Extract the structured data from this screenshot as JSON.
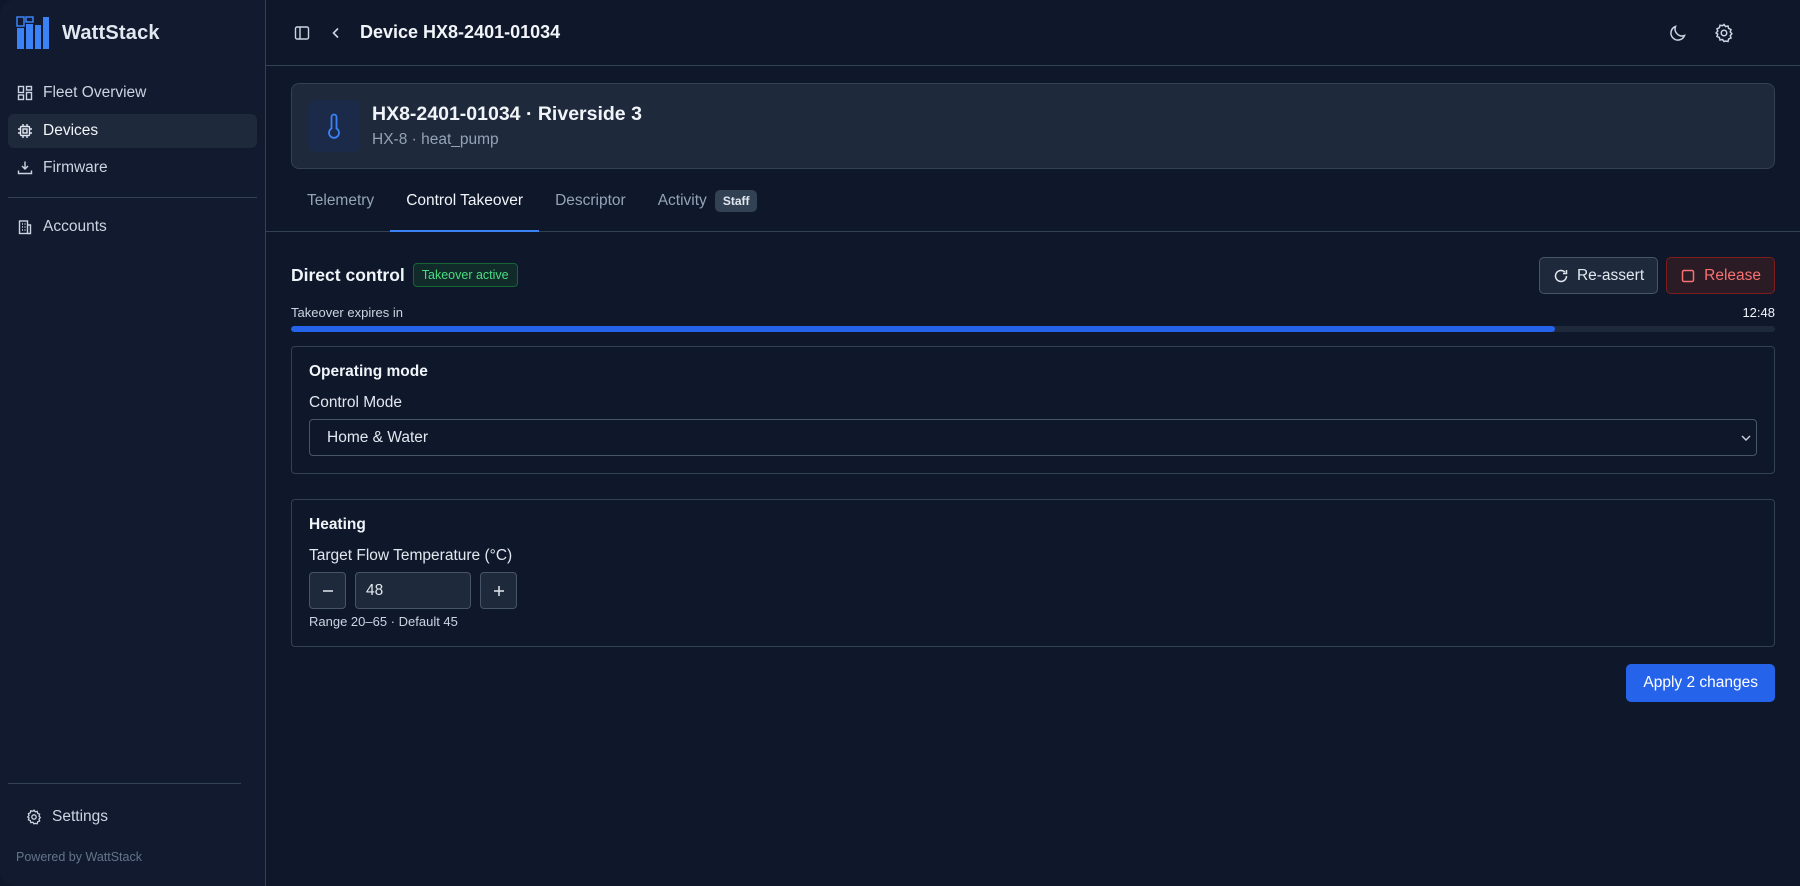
{
  "brand": {
    "name": "WattStack",
    "logo_icon": "wattstack-logo-icon",
    "accent": "#3b82f6"
  },
  "sidebar": {
    "items": [
      {
        "label": "Fleet Overview",
        "icon": "dashboard-icon"
      },
      {
        "label": "Devices",
        "icon": "chip-icon",
        "active": true
      },
      {
        "label": "Firmware",
        "icon": "download-icon"
      },
      {
        "label": "Accounts",
        "icon": "building-icon"
      }
    ],
    "settings_label": "Settings",
    "powered_by": "Powered by WattStack"
  },
  "header": {
    "title": "Device HX8-2401-01034",
    "icons": [
      "sidebar-toggle-icon",
      "back-chevron-icon",
      "moon-icon",
      "gear-icon"
    ]
  },
  "device": {
    "title": "HX8-2401-01034 · Riverside 3",
    "subtitle": "HX-8 · heat_pump",
    "icon": "thermometer-icon"
  },
  "tabs": [
    {
      "label": "Telemetry"
    },
    {
      "label": "Control Takeover",
      "active": true
    },
    {
      "label": "Descriptor"
    },
    {
      "label": "Activity",
      "badge": "Staff"
    }
  ],
  "control": {
    "title": "Direct control",
    "status_badge": "Takeover active",
    "reassert_label": "Re-assert",
    "release_label": "Release",
    "expiry_label": "Takeover expires in",
    "expiry_value": "12:48",
    "expiry_progress": 0.852,
    "status_color": "#4ade80",
    "release_color": "#f87171"
  },
  "operating_mode": {
    "heading": "Operating mode",
    "field_label": "Control Mode",
    "selected": "Home & Water"
  },
  "heating": {
    "heading": "Heating",
    "field_label": "Target Flow Temperature (°C)",
    "value": "48",
    "hint": "Range 20–65 · Default 45"
  },
  "apply_label": "Apply 2 changes"
}
